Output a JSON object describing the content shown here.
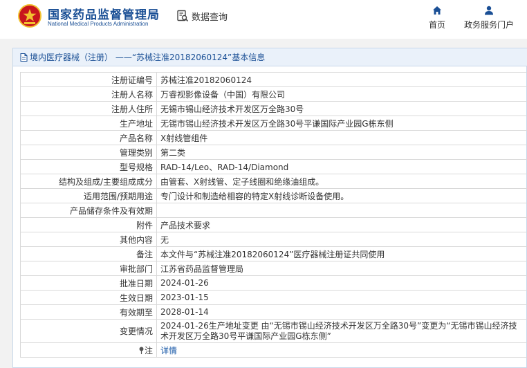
{
  "header": {
    "brand_cn": "国家药品监督管理局",
    "brand_en": "National Medical Products Administration",
    "query_label": "数据查询",
    "nav": [
      {
        "label": "首页",
        "icon": "home-icon"
      },
      {
        "label": "政务服务门户",
        "icon": "user-icon"
      }
    ]
  },
  "panel": {
    "title": "境内医疗器械（注册） ——“苏械注准20182060124”基本信息"
  },
  "rows": [
    {
      "key": "注册证编号",
      "value": "苏械注准20182060124"
    },
    {
      "key": "注册人名称",
      "value": "万睿视影像设备（中国）有限公司"
    },
    {
      "key": "注册人住所",
      "value": "无锡市锡山经济技术开发区万全路30号"
    },
    {
      "key": "生产地址",
      "value": "无锡市锡山经济技术开发区万全路30号平谦国际产业园G栋东侧"
    },
    {
      "key": "产品名称",
      "value": "X射线管组件"
    },
    {
      "key": "管理类别",
      "value": "第二类"
    },
    {
      "key": "型号规格",
      "value": "RAD-14/Leo、RAD-14/Diamond"
    },
    {
      "key": "结构及组成/主要组成成分",
      "value": "由管套、X射线管、定子线圈和绝缘油组成。"
    },
    {
      "key": "适用范围/预期用途",
      "value": "专门设计和制造给相容的特定X射线诊断设备使用。"
    },
    {
      "key": "产品储存条件及有效期",
      "value": ""
    },
    {
      "key": "附件",
      "value": "产品技术要求"
    },
    {
      "key": "其他内容",
      "value": "无"
    },
    {
      "key": "备注",
      "value": "本文件与“苏械注准20182060124”医疗器械注册证共同使用"
    },
    {
      "key": "审批部门",
      "value": "江苏省药品监督管理局"
    },
    {
      "key": "批准日期",
      "value": "2024-01-26"
    },
    {
      "key": "生效日期",
      "value": "2023-01-15"
    },
    {
      "key": "有效期至",
      "value": "2028-01-14"
    },
    {
      "key": "变更情况",
      "value": "2024-01-26生产地址变更 由“无锡市锡山经济技术开发区万全路30号”变更为“无锡市锡山经济技术开发区万全路30号平谦国际产业园G栋东侧”"
    }
  ],
  "note_row": {
    "key": "注",
    "link": "详情"
  },
  "colors": {
    "brand_blue": "#1a4f95",
    "link_blue": "#1a5aa8",
    "panel_bg": "#eaf1fa",
    "logo_red": "#c8161d",
    "logo_gold": "#f2c230"
  }
}
